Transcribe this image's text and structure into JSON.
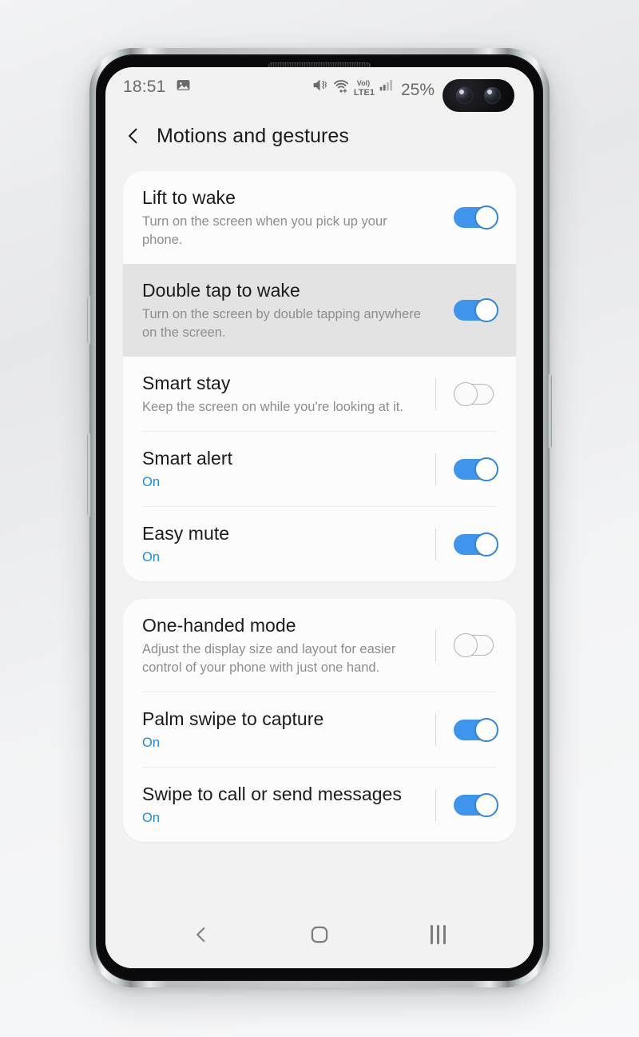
{
  "status_bar": {
    "clock": "18:51",
    "left_icons": [
      {
        "name": "image-icon",
        "glyph": "image"
      }
    ],
    "right_icons": [
      {
        "name": "mute-vibrate-icon",
        "glyph": "mute"
      },
      {
        "name": "wifi-icon",
        "glyph": "wifi"
      },
      {
        "name": "signal-bars-icon",
        "glyph": "signal"
      }
    ],
    "volte_label": "Vol)",
    "network_label": "LTE1",
    "battery_percent": "25%"
  },
  "app_bar": {
    "back_icon": "back-chevron-icon",
    "title": "Motions and gestures"
  },
  "colors": {
    "accent": "#1a8fe0",
    "toggle_on_track": "#3f95ec",
    "toggle_on_border": "#2f86e0",
    "toggle_off_border": "#b4b4b4",
    "screen_bg": "#f2f2f2",
    "card_bg": "#fcfcfc",
    "pressed_bg": "#e3e3e3"
  },
  "cards": [
    {
      "name": "wake-and-alert-card",
      "rows": [
        {
          "name": "row-lift-to-wake",
          "title": "Lift to wake",
          "subtitle": "Turn on the screen when you pick up your phone.",
          "subtitle_accent": false,
          "toggle": "on",
          "pressed": false,
          "separator": false,
          "divider_after": false
        },
        {
          "name": "row-double-tap-to-wake",
          "title": "Double tap to wake",
          "subtitle": "Turn on the screen by double tapping anywhere on the screen.",
          "subtitle_accent": false,
          "toggle": "on",
          "pressed": true,
          "separator": false,
          "divider_after": false
        },
        {
          "name": "row-smart-stay",
          "title": "Smart stay",
          "subtitle": "Keep the screen on while you're looking at it.",
          "subtitle_accent": false,
          "toggle": "off",
          "pressed": false,
          "separator": true,
          "divider_after": true
        },
        {
          "name": "row-smart-alert",
          "title": "Smart alert",
          "subtitle": "On",
          "subtitle_accent": true,
          "toggle": "on",
          "pressed": false,
          "separator": true,
          "divider_after": true
        },
        {
          "name": "row-easy-mute",
          "title": "Easy mute",
          "subtitle": "On",
          "subtitle_accent": true,
          "toggle": "on",
          "pressed": false,
          "separator": true,
          "divider_after": false
        }
      ]
    },
    {
      "name": "gestures-card",
      "rows": [
        {
          "name": "row-one-handed-mode",
          "title": "One-handed mode",
          "subtitle": "Adjust the display size and layout for easier control of your phone with just one hand.",
          "subtitle_accent": false,
          "toggle": "off",
          "pressed": false,
          "separator": true,
          "divider_after": true
        },
        {
          "name": "row-palm-swipe-to-capture",
          "title": "Palm swipe to capture",
          "subtitle": "On",
          "subtitle_accent": true,
          "toggle": "on",
          "pressed": false,
          "separator": true,
          "divider_after": true
        },
        {
          "name": "row-swipe-to-call-or-send-messages",
          "title": "Swipe to call or send messages",
          "subtitle": "On",
          "subtitle_accent": true,
          "toggle": "on",
          "pressed": false,
          "separator": true,
          "divider_after": false
        }
      ]
    }
  ],
  "nav_bar": {
    "buttons": [
      {
        "name": "nav-back-button",
        "icon": "back-chevron-icon"
      },
      {
        "name": "nav-home-button",
        "icon": "home-square-icon"
      },
      {
        "name": "nav-recents-button",
        "icon": "recents-bars-icon"
      }
    ]
  }
}
